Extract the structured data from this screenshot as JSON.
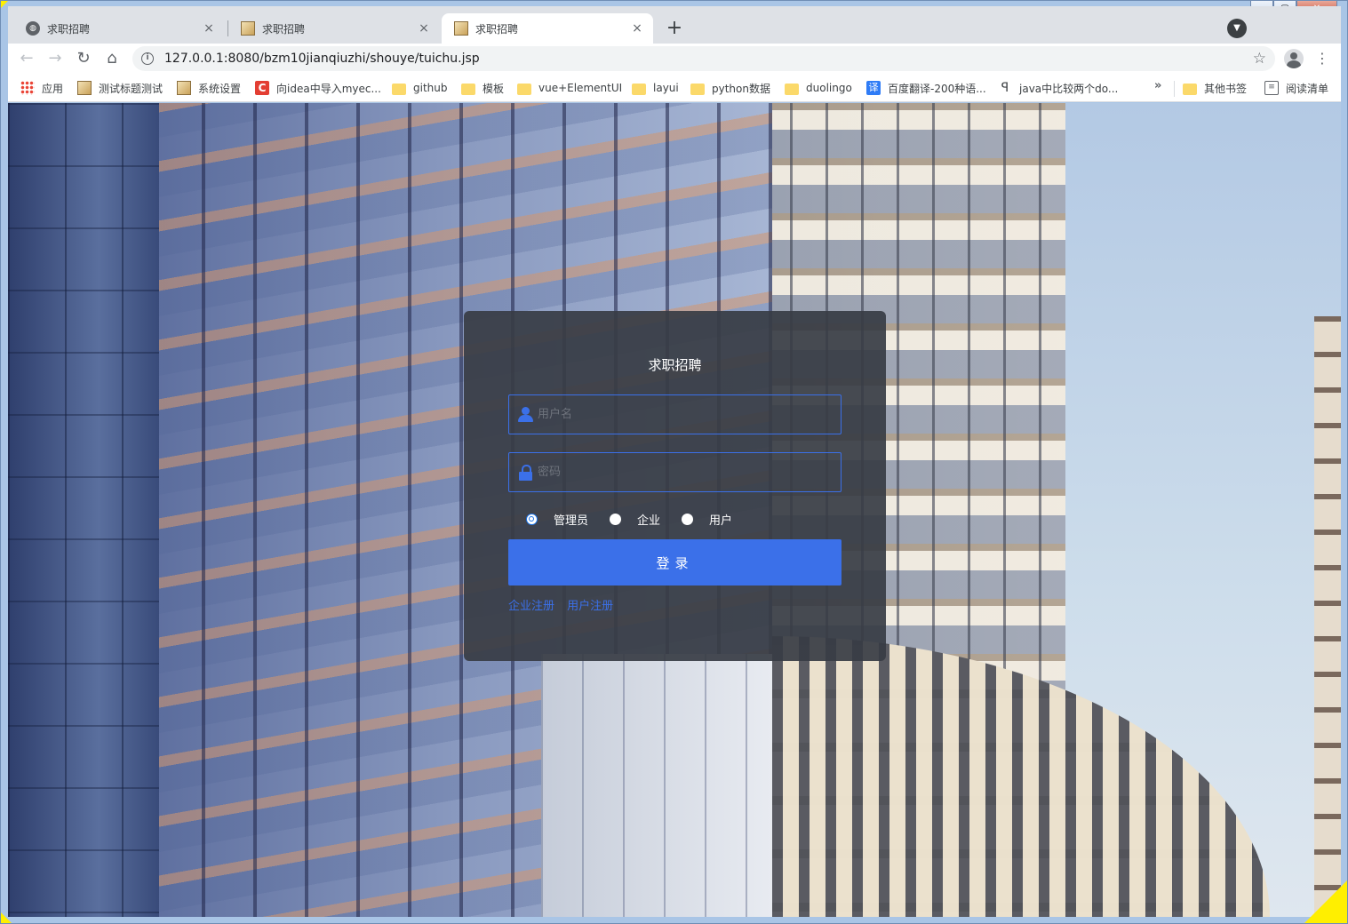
{
  "browser": {
    "tabs": [
      {
        "title": "求职招聘",
        "icon": "globe-icon",
        "active": false
      },
      {
        "title": "求职招聘",
        "icon": "page-icon",
        "active": false
      },
      {
        "title": "求职招聘",
        "icon": "page-icon",
        "active": true
      }
    ],
    "new_tab_label": "+",
    "close_glyph": "×",
    "url": "127.0.0.1:8080/bzm10jianqiuzhi/shouye/tuichu.jsp",
    "bookmarks": [
      {
        "label": "应用",
        "icon": "apps-icon"
      },
      {
        "label": "测试标题测试",
        "icon": "page-icon"
      },
      {
        "label": "系统设置",
        "icon": "page-icon"
      },
      {
        "label": "向idea中导入myec...",
        "icon": "csdn-icon"
      },
      {
        "label": "github",
        "icon": "folder-icon"
      },
      {
        "label": "模板",
        "icon": "folder-icon"
      },
      {
        "label": "vue+ElementUI",
        "icon": "folder-icon"
      },
      {
        "label": "layui",
        "icon": "folder-icon"
      },
      {
        "label": "python数据",
        "icon": "folder-icon"
      },
      {
        "label": "duolingo",
        "icon": "folder-icon"
      },
      {
        "label": "百度翻译-200种语...",
        "icon": "translate-icon"
      },
      {
        "label": "java中比较两个do...",
        "icon": "java-icon"
      },
      {
        "label": "其他书签",
        "icon": "folder-icon"
      },
      {
        "label": "阅读清单",
        "icon": "reading-list-icon"
      }
    ],
    "overflow_label": "»"
  },
  "login": {
    "title": "求职招聘",
    "username_placeholder": "用户名",
    "password_placeholder": "密码",
    "roles": [
      {
        "label": "管理员",
        "checked": true
      },
      {
        "label": "企业",
        "checked": false
      },
      {
        "label": "用户",
        "checked": false
      }
    ],
    "submit_label": "登录",
    "links": [
      "企业注册",
      "用户注册"
    ],
    "accent_color": "#3b70e9"
  }
}
